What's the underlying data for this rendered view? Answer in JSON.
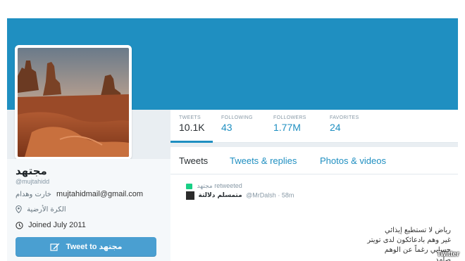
{
  "profile": {
    "display_name": "مجتهد",
    "handle": "@mujtahidd",
    "bio_arabic": "خارت وهدام",
    "bio_email": "mujtahidmail@gmail.com",
    "location": "الكرة الأرضية",
    "joined": "Joined July 2011",
    "tweet_button": "Tweet to مجتهد"
  },
  "stats": [
    {
      "label": "TWEETS",
      "value": "10.1K"
    },
    {
      "label": "FOLLOWING",
      "value": "43"
    },
    {
      "label": "FOLLOWERS",
      "value": "1.77M"
    },
    {
      "label": "FAVORITES",
      "value": "24"
    }
  ],
  "tabs": [
    "Tweets",
    "Tweets & replies",
    "Photos & videos"
  ],
  "tweet": {
    "retweet_text": "مجتهد retweeted",
    "author_name": "متمسلم دلالتة",
    "author_handle": "@MrDalsh",
    "time": "58m",
    "body_lines": [
      "رياض لا تستطيع إيذائي",
      "غير وهم بادعائكون لدى تويتر",
      "حسابي رغماً عن الوهم",
      "صامد"
    ]
  },
  "watermark": "Twitter",
  "colors": {
    "banner": "#1f8fc1",
    "link": "#1f8fc1",
    "button": "#4a9fd1",
    "retweet": "#19cf86"
  }
}
